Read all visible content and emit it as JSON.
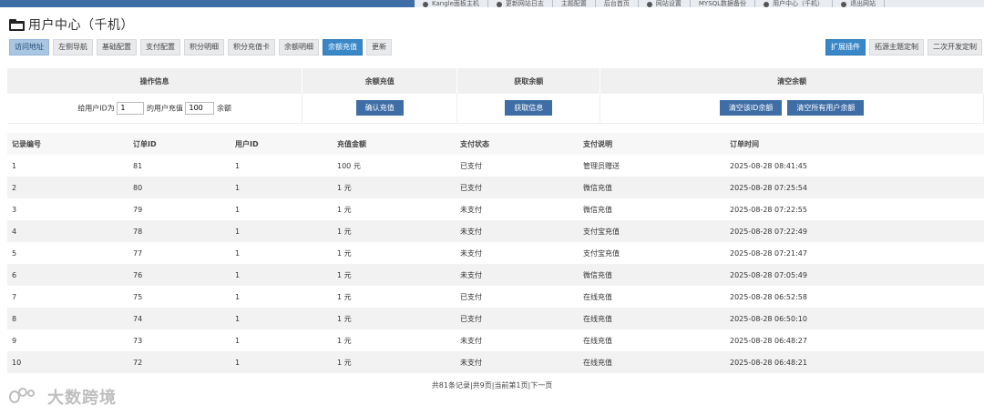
{
  "top_bar": {
    "links": [
      {
        "icon": "gear-icon",
        "label": "Kangle面板主机"
      },
      {
        "icon": "gear-icon",
        "label": "更新网站日志"
      },
      {
        "icon": "",
        "label": "主题配置"
      },
      {
        "icon": "",
        "label": "后台首页"
      },
      {
        "icon": "gear-icon",
        "label": "网站设置"
      },
      {
        "icon": "",
        "label": "MYSQL数据备份"
      },
      {
        "icon": "user-icon",
        "label": "用户中心（千机）"
      },
      {
        "icon": "power-icon",
        "label": "退出网站"
      }
    ]
  },
  "page": {
    "title": "用户中心（千机）"
  },
  "nav": {
    "tabs": [
      {
        "label": "访问地址",
        "state": "first"
      },
      {
        "label": "左侧导航",
        "state": ""
      },
      {
        "label": "基础配置",
        "state": ""
      },
      {
        "label": "支付配置",
        "state": ""
      },
      {
        "label": "积分明细",
        "state": ""
      },
      {
        "label": "积分充值卡",
        "state": ""
      },
      {
        "label": "余额明细",
        "state": ""
      },
      {
        "label": "余额充值",
        "state": "active"
      },
      {
        "label": "更新",
        "state": ""
      }
    ],
    "right": [
      {
        "label": "扩展插件",
        "state": "primary"
      },
      {
        "label": "拓源主题定制",
        "state": ""
      },
      {
        "label": "二次开发定制",
        "state": ""
      }
    ]
  },
  "operations": {
    "headers": [
      "操作信息",
      "余额充值",
      "获取余额",
      "清空余额"
    ],
    "recharge_prefix": "给用户ID为",
    "user_id_value": "1",
    "recharge_middle": "的用户充值",
    "amount_value": "100",
    "recharge_suffix": "余额",
    "confirm_button": "确认充值",
    "get_info_button": "获取信息",
    "clear_id_button": "清空该ID余额",
    "clear_all_button": "清空所有用户余额"
  },
  "records": {
    "columns": [
      "记录编号",
      "订单ID",
      "用户ID",
      "充值金额",
      "支付状态",
      "支付说明",
      "订单时间"
    ],
    "rows": [
      [
        "1",
        "81",
        "1",
        "100 元",
        "已支付",
        "管理员赠送",
        "2025-08-28 08:41:45"
      ],
      [
        "2",
        "80",
        "1",
        "1 元",
        "已支付",
        "微信充值",
        "2025-08-28 07:25:54"
      ],
      [
        "3",
        "79",
        "1",
        "1 元",
        "未支付",
        "微信充值",
        "2025-08-28 07:22:55"
      ],
      [
        "4",
        "78",
        "1",
        "1 元",
        "未支付",
        "支付宝充值",
        "2025-08-28 07:22:49"
      ],
      [
        "5",
        "77",
        "1",
        "1 元",
        "未支付",
        "支付宝充值",
        "2025-08-28 07:21:47"
      ],
      [
        "6",
        "76",
        "1",
        "1 元",
        "未支付",
        "微信充值",
        "2025-08-28 07:05:49"
      ],
      [
        "7",
        "75",
        "1",
        "1 元",
        "已支付",
        "在线充值",
        "2025-08-28 06:52:58"
      ],
      [
        "8",
        "74",
        "1",
        "1 元",
        "已支付",
        "在线充值",
        "2025-08-28 06:50:10"
      ],
      [
        "9",
        "73",
        "1",
        "1 元",
        "未支付",
        "在线充值",
        "2025-08-28 06:48:27"
      ],
      [
        "10",
        "72",
        "1",
        "1 元",
        "未支付",
        "在线充值",
        "2025-08-28 06:48:21"
      ]
    ]
  },
  "pagination": {
    "text": "共81条记录|共9页|当前第1页|下一页"
  },
  "watermark": {
    "text": "大数跨境"
  },
  "colors": {
    "primary": "#3a87c8",
    "button_dark": "#3f6ea7",
    "top_accent": "#3e6ea6"
  }
}
